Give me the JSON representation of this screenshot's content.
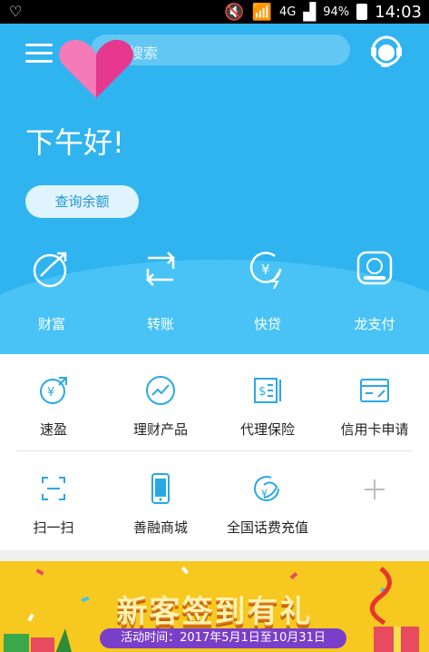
{
  "status_bar": {
    "network": "4G",
    "battery": "94%",
    "time": "14:03"
  },
  "header": {
    "search_placeholder": "搜索"
  },
  "greeting": "下午好!",
  "balance_button": "查询余额",
  "quick_actions": [
    {
      "label": "财富",
      "icon": "wealth-icon"
    },
    {
      "label": "转账",
      "icon": "transfer-icon"
    },
    {
      "label": "快贷",
      "icon": "quick-loan-icon"
    },
    {
      "label": "龙支付",
      "icon": "long-pay-icon"
    }
  ],
  "services": [
    {
      "label": "速盈",
      "icon": "suying-icon"
    },
    {
      "label": "理财产品",
      "icon": "wealth-product-icon"
    },
    {
      "label": "代理保险",
      "icon": "insurance-icon"
    },
    {
      "label": "信用卡申请",
      "icon": "credit-card-icon"
    },
    {
      "label": "扫一扫",
      "icon": "scan-icon"
    },
    {
      "label": "善融商城",
      "icon": "mall-icon"
    },
    {
      "label": "全国话费充值",
      "icon": "phone-recharge-icon"
    },
    {
      "label": "",
      "icon": "add-icon"
    }
  ],
  "banner": {
    "title": "新客签到有礼",
    "period": "活动时间：2017年5月1日至10月31日"
  },
  "colors": {
    "header_blue": "#2fb4f0",
    "accent_blue": "#2196d6",
    "banner_yellow": "#f7c81f"
  }
}
